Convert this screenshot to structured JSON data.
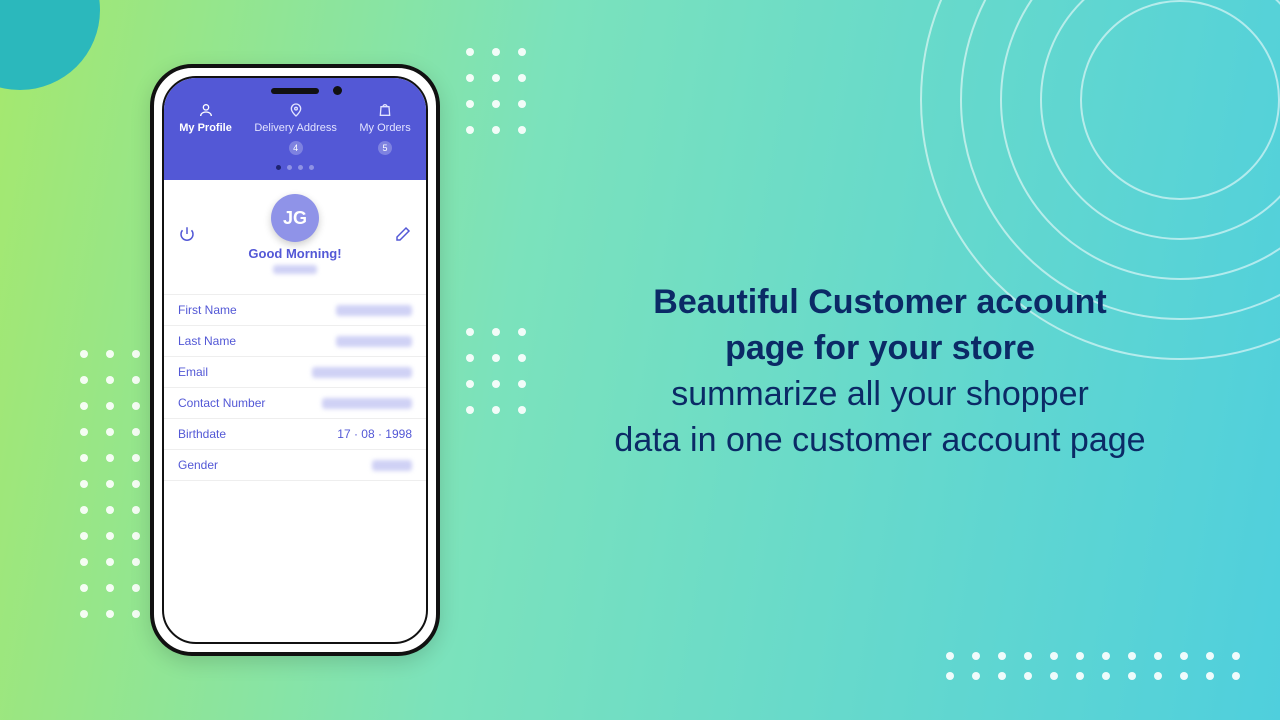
{
  "tabs": {
    "profile": "My Profile",
    "delivery": "Delivery Address",
    "orders": "My Orders",
    "delivery_count": "4",
    "orders_count": "5"
  },
  "profile": {
    "initials": "JG",
    "greeting": "Good Morning!"
  },
  "fields": {
    "first_name": "First Name",
    "last_name": "Last Name",
    "email": "Email",
    "contact": "Contact Number",
    "birthdate": "Birthdate",
    "birthdate_value": "17 · 08 · 1998",
    "gender": "Gender"
  },
  "marketing": {
    "title_line1": "Beautiful Customer account",
    "title_line2": "page for your store",
    "sub_line1": "summarize all your shopper",
    "sub_line2": "data in one customer account page"
  }
}
